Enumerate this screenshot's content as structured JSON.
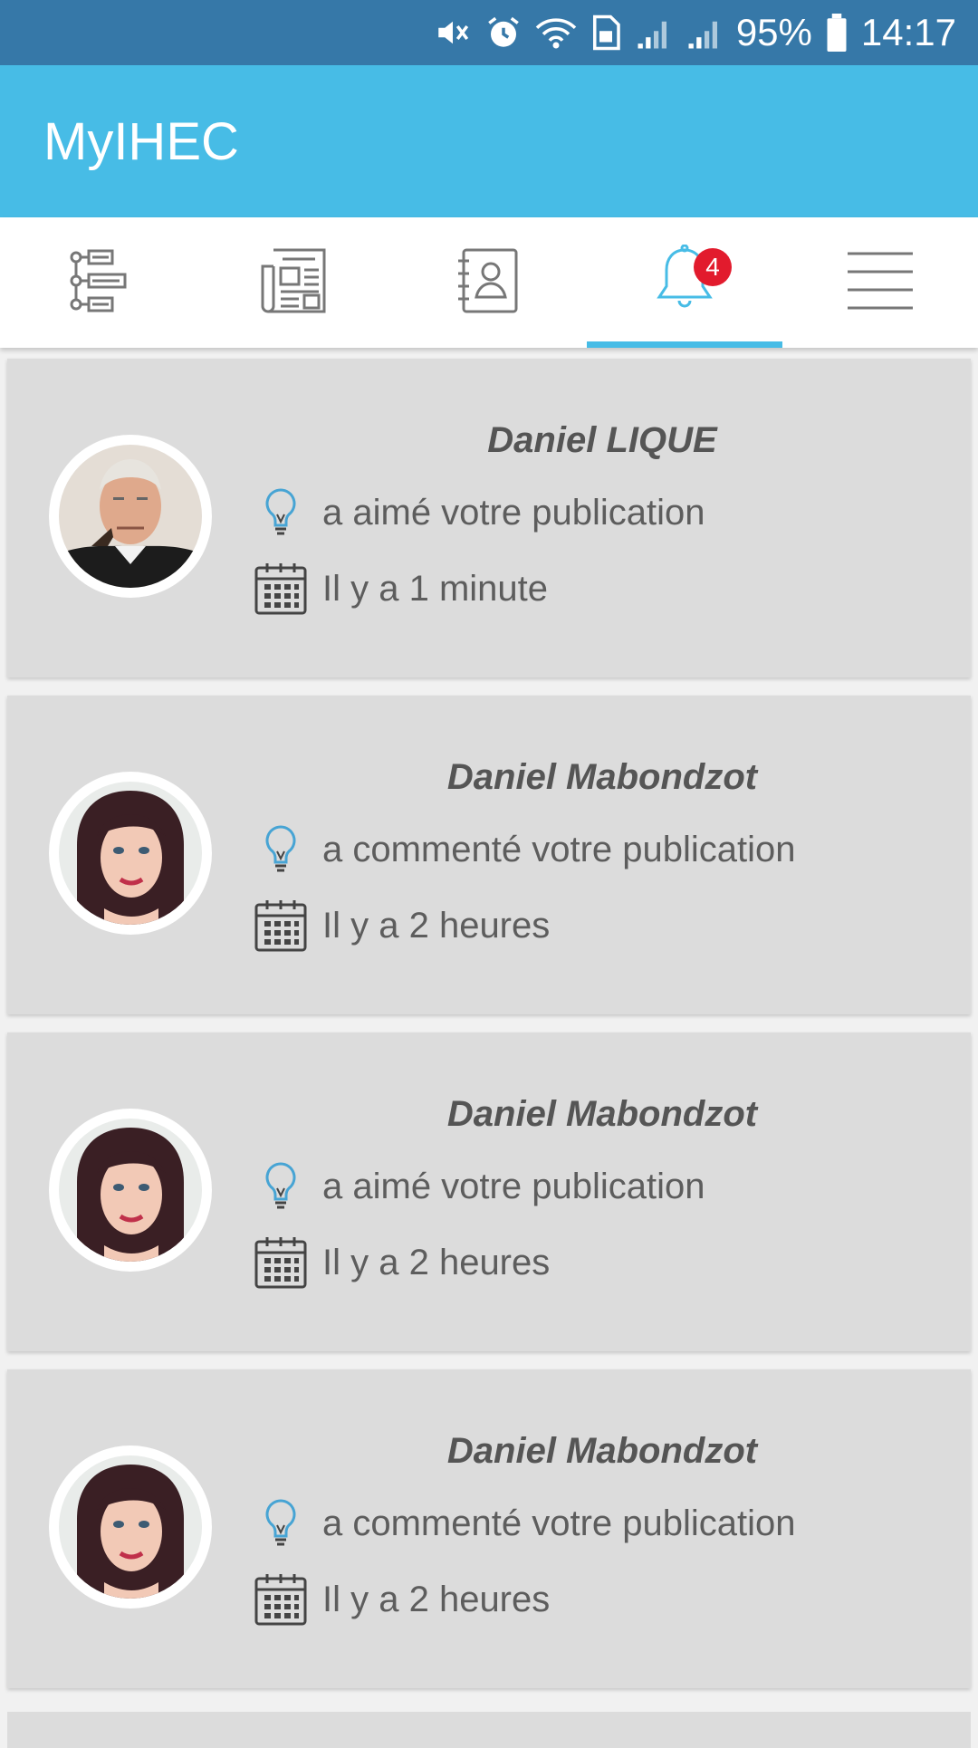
{
  "status_bar": {
    "battery": "95%",
    "time": "14:17"
  },
  "app": {
    "title": "MyIHEC"
  },
  "tabs": [
    {
      "icon": "timeline-icon"
    },
    {
      "icon": "newspaper-icon"
    },
    {
      "icon": "contacts-icon"
    },
    {
      "icon": "bell-icon",
      "badge": "4",
      "active": true
    },
    {
      "icon": "menu-icon"
    }
  ],
  "notifications": [
    {
      "name": "Daniel LIQUE",
      "action": "a aimé votre publication",
      "time": "Il y a 1 minute",
      "avatar": "elderly-man"
    },
    {
      "name": "Daniel Mabondzot",
      "action": "a commenté votre publication",
      "time": "Il y a 2 heures",
      "avatar": "woman"
    },
    {
      "name": "Daniel Mabondzot",
      "action": "a aimé votre publication",
      "time": "Il y a 2 heures",
      "avatar": "woman"
    },
    {
      "name": "Daniel Mabondzot",
      "action": "a commenté votre publication",
      "time": "Il y a 2 heures",
      "avatar": "woman"
    }
  ],
  "colors": {
    "status_bar": "#3678a8",
    "app_bar": "#47bce6",
    "accent": "#47bce6",
    "badge": "#e21b2d",
    "card": "#dcdcdc"
  }
}
